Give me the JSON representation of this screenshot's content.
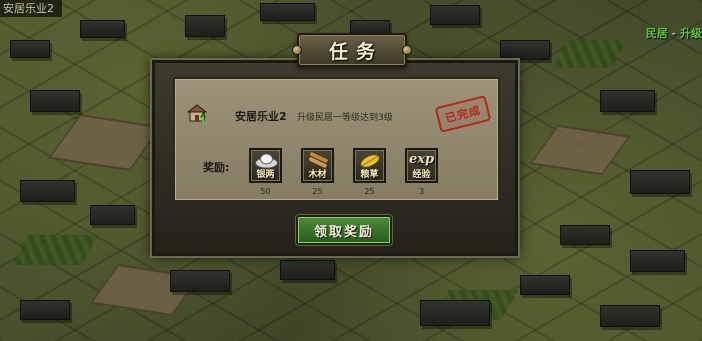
{
  "map": {
    "top_left_label": "安居乐业2",
    "top_right_label": "民居",
    "top_right_label_suffix": "升级"
  },
  "dialog": {
    "title": "任务",
    "quest": {
      "name": "安居乐业2",
      "description": "升级民居一等级达到3级",
      "status_stamp": "已完成"
    },
    "rewards_label": "奖励:",
    "rewards": [
      {
        "name": "银两",
        "count": "50",
        "icon": "silver-ingot-icon"
      },
      {
        "name": "木材",
        "count": "25",
        "icon": "wood-logs-icon"
      },
      {
        "name": "粮草",
        "count": "25",
        "icon": "grain-icon"
      },
      {
        "name": "经验",
        "count": "3",
        "icon": "exp-icon",
        "badge": "exp"
      }
    ],
    "claim_button": "领取奖励"
  }
}
